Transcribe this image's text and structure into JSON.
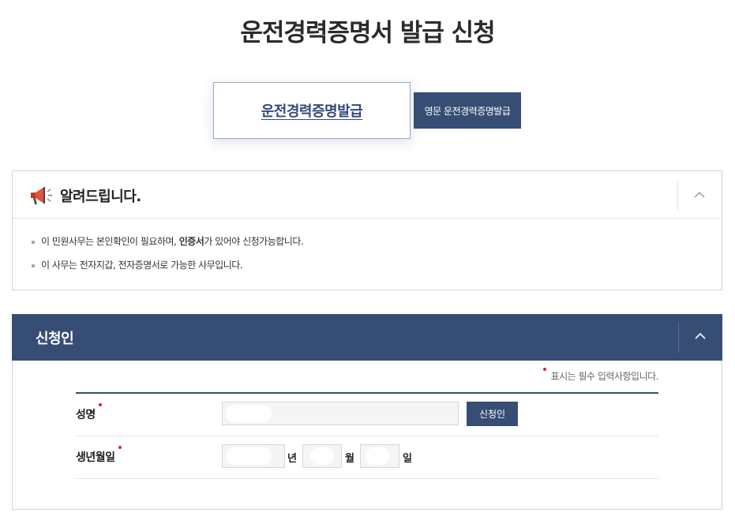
{
  "page": {
    "title": "운전경력증명서 발급 신청"
  },
  "tabs": [
    {
      "label": "운전경력증명발급",
      "active": true
    },
    {
      "label": "영문 운전경력증명발급",
      "active": false
    }
  ],
  "notice": {
    "title": "알려드립니다.",
    "line1_pre": "이 민원사무는 본인확인이 필요하며, ",
    "line1_bold": "인증서",
    "line1_post": "가 있어야 신청가능합니다.",
    "line2": "이 사무는 전자지갑, 전자증명서로 가능한 사무입니다."
  },
  "applicant": {
    "section_title": "신청인",
    "required_note": "표시는 필수 입력사항입니다.",
    "name_label": "성명",
    "name_button": "신청인",
    "birth_label": "생년월일",
    "year_unit": "년",
    "month_unit": "월",
    "day_unit": "일"
  },
  "colors": {
    "primary": "#364d74",
    "required": "#e0202a"
  }
}
